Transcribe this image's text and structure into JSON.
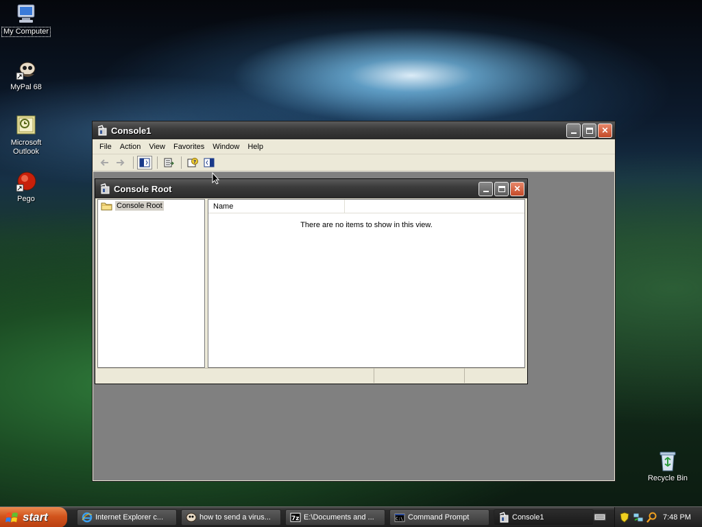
{
  "desktop": {
    "icons": [
      {
        "label": "My Computer"
      },
      {
        "label": "MyPal 68"
      },
      {
        "label": "Microsoft\nOutlook"
      },
      {
        "label": "Pego"
      },
      {
        "label": "Recycle Bin"
      }
    ]
  },
  "console_window": {
    "title": "Console1",
    "menu": [
      "File",
      "Action",
      "View",
      "Favorites",
      "Window",
      "Help"
    ]
  },
  "console_root": {
    "title": "Console Root",
    "tree_item": "Console Root",
    "column_header": "Name",
    "empty_message": "There are no items to show in this view."
  },
  "taskbar": {
    "start_label": "start",
    "tasks": [
      {
        "label": "Internet Explorer c..."
      },
      {
        "label": "how to send a virus..."
      },
      {
        "label": "E:\\Documents and ..."
      },
      {
        "label": "Command Prompt"
      },
      {
        "label": "Console1"
      }
    ],
    "clock": "7:48 PM"
  }
}
